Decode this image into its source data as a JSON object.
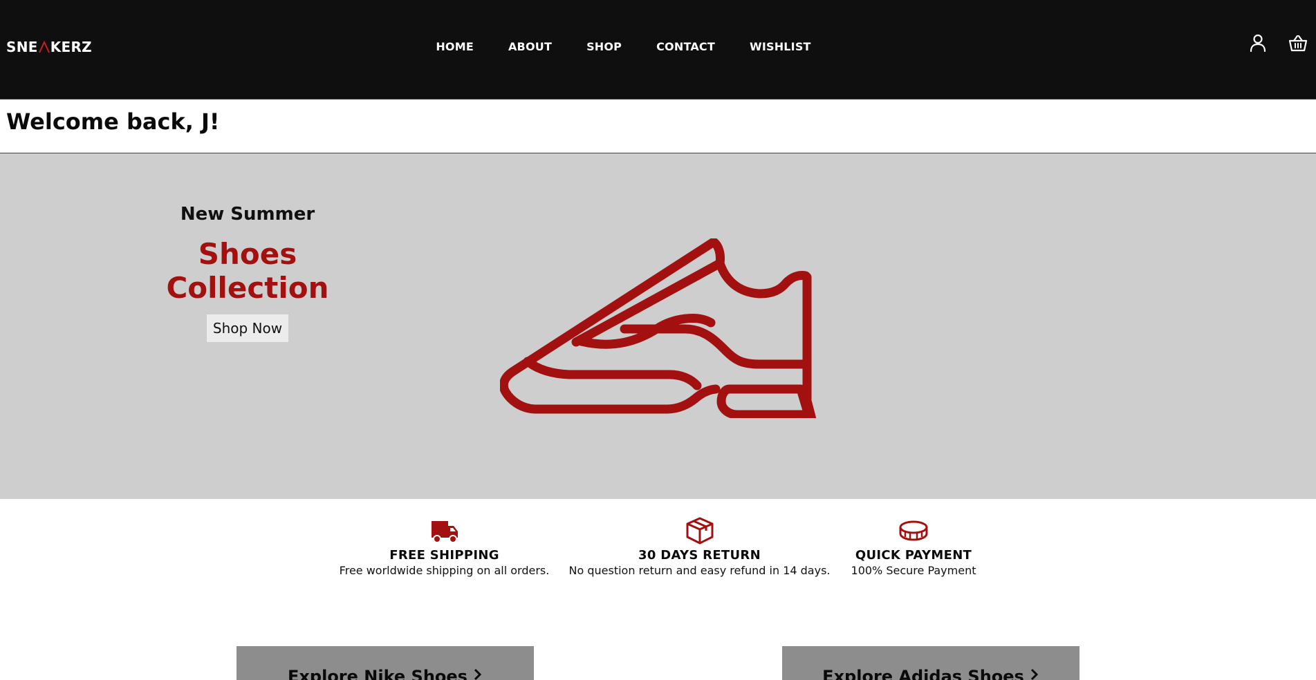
{
  "brand": {
    "logo_text_left": "SNE",
    "logo_text_right": "KERZ"
  },
  "nav": {
    "links": [
      "HOME",
      "ABOUT",
      "SHOP",
      "CONTACT",
      "WISHLIST"
    ],
    "icons": [
      "user-icon",
      "basket-icon"
    ]
  },
  "welcome": {
    "message": "Welcome back, J!"
  },
  "hero": {
    "kicker": "New Summer",
    "title": "Shoes Collection",
    "button_label": "Shop Now",
    "image_icon": "sneaker-icon"
  },
  "features": [
    {
      "icon": "truck-icon",
      "title": "FREE SHIPPING",
      "desc": "Free worldwide shipping on all orders."
    },
    {
      "icon": "box-icon",
      "title": "30 DAYS RETURN",
      "desc": "No question return and easy refund in 14 days."
    },
    {
      "icon": "coin-icon",
      "title": "QUICK PAYMENT",
      "desc": "100% Secure Payment"
    }
  ],
  "explore": {
    "nike": "Explore Nike Shoes",
    "adidas": "Explore Adidas Shoes"
  },
  "colors": {
    "accent": "#a31010",
    "navbar": "#0f0f0f",
    "hero_bg": "#cecece",
    "explore_bg": "#8d8d8d"
  }
}
